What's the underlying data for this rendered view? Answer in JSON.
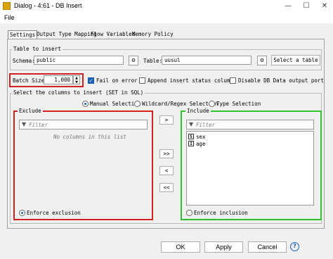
{
  "window": {
    "title": "Dialog - 4:61 - DB Insert"
  },
  "menu": {
    "file": "File"
  },
  "tabs": [
    "Settings",
    "Output Type Mapping",
    "Flow Variables",
    "Memory Policy"
  ],
  "table_to_insert": {
    "legend": "Table to insert",
    "schema_label": "Schema:",
    "schema_value": "public",
    "table_label": "Table:",
    "table_value": "uusul",
    "select_table_button": "Select a table"
  },
  "options": {
    "batch_size_label": "Batch Size:",
    "batch_size_value": "1,000",
    "fail_on_error": "Fail on error",
    "append_status": "Append insert status columns",
    "disable_output": "Disable DB Data output port"
  },
  "columns": {
    "legend": "Select the columns to insert (SET in SQL)",
    "modes": [
      "Manual Selection",
      "Wildcard/Regex Selection",
      "Type Selection"
    ],
    "exclude_label": "Exclude",
    "include_label": "Include",
    "filter_placeholder": "Filter",
    "empty_text": "No columns in this list",
    "include_items": [
      {
        "type": "S",
        "name": "sex"
      },
      {
        "type": "I",
        "name": "age"
      }
    ],
    "enforce_exclusion": "Enforce exclusion",
    "enforce_inclusion": "Enforce inclusion",
    "move_buttons": [
      ">",
      ">>",
      "<",
      "<<"
    ]
  },
  "footer": {
    "ok": "OK",
    "apply": "Apply",
    "cancel": "Cancel",
    "help": "?"
  },
  "colors": {
    "highlight_red": "#d02020",
    "highlight_green": "#30c030",
    "accent": "#1a5fb4"
  }
}
